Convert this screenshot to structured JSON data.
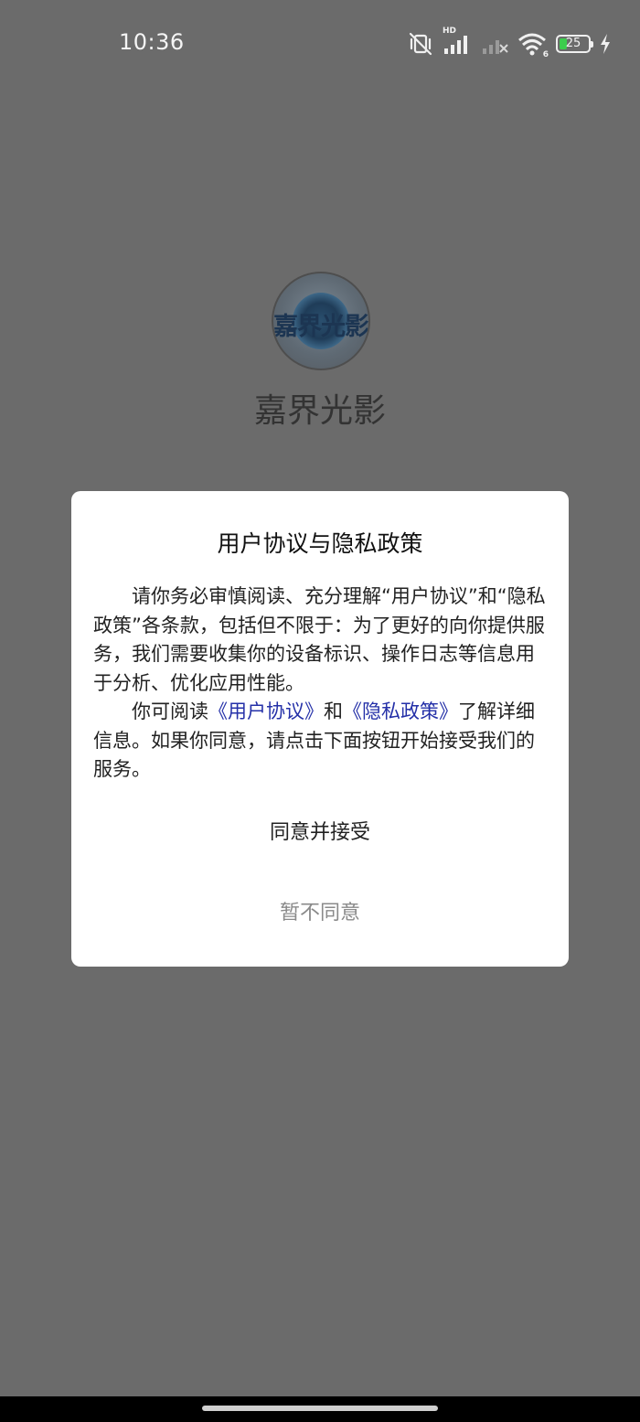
{
  "status_bar": {
    "time": "10:36",
    "battery_level": "25",
    "battery_fraction": 0.25,
    "icons": [
      "mute-vibrate-icon",
      "hd-signal-icon",
      "signal-no-service-icon",
      "wifi-icon",
      "battery-icon",
      "charging-icon"
    ],
    "hd_label": "HD",
    "wifi_label": "6"
  },
  "app": {
    "logo_text": "嘉界光影",
    "name": "嘉界光影"
  },
  "dialog": {
    "title": "用户协议与隐私政策",
    "paragraph1": "请你务必审慎阅读、充分理解“用户协议”和“隐私政策”各条款，包括但不限于：为了更好的向你提供服务，我们需要收集你的设备标识、操作日志等信息用于分析、优化应用性能。",
    "paragraph2_prefix": "你可阅读",
    "user_agreement_link": "《用户协议》",
    "paragraph2_and": "和",
    "privacy_policy_link": "《隐私政策》",
    "paragraph2_suffix": "了解详细信息。如果你同意，请点击下面按钮开始接受我们的服务。",
    "agree_button": "同意并接受",
    "decline_button": "暂不同意"
  },
  "colors": {
    "backdrop": "#6b6b6b",
    "link": "#2430a8",
    "battery_fill": "#3ccd4d"
  }
}
